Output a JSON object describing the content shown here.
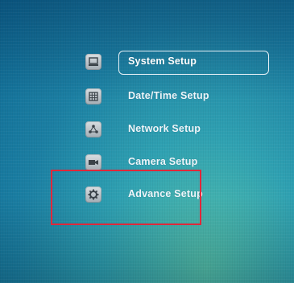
{
  "menu": {
    "items": [
      {
        "label": "System Setup",
        "icon": "computer-icon",
        "selected": true
      },
      {
        "label": "Date/Time Setup",
        "icon": "calendar-grid-icon",
        "selected": false
      },
      {
        "label": "Network Setup",
        "icon": "network-icon",
        "selected": false
      },
      {
        "label": "Camera Setup",
        "icon": "camera-icon",
        "selected": false
      },
      {
        "label": "Advance Setup",
        "icon": "gear-icon",
        "selected": false
      }
    ]
  },
  "colors": {
    "background_dark": "#0f6a94",
    "background_light": "#56c2ab",
    "text": "#eef6fb",
    "selection_border": "#e6f0f6",
    "annotation_box": "#e0283a"
  }
}
